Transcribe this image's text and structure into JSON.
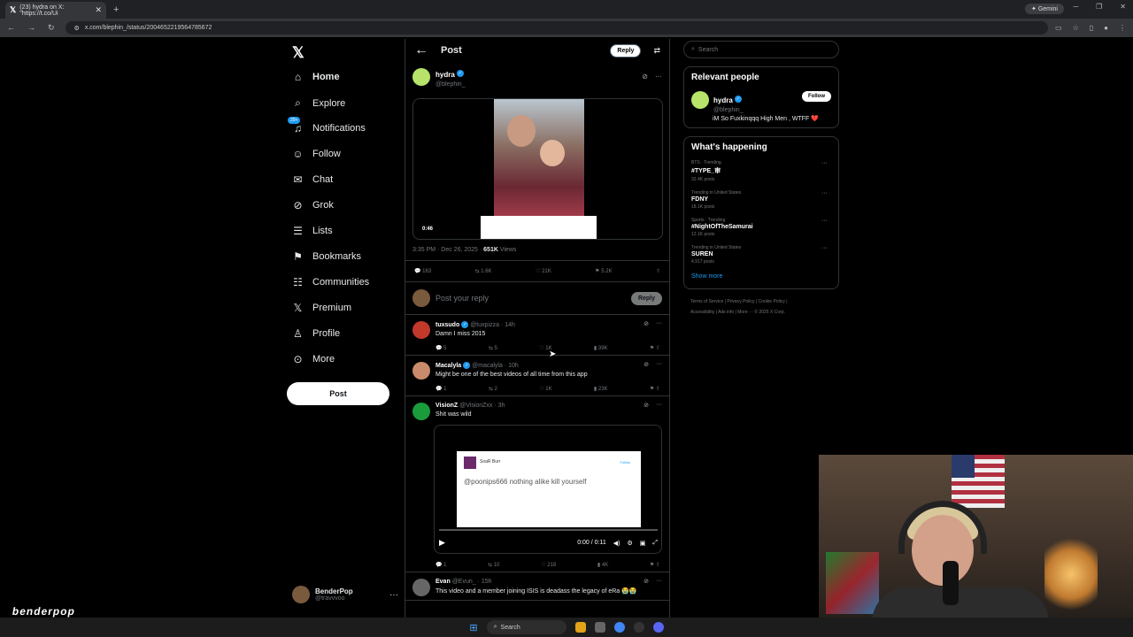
{
  "browser": {
    "tab_title": "(23) hydra on X: \"https://t.co/Ui",
    "gemini_label": "Gemini",
    "url": "x.com/blephin_/status/2004652219564785672"
  },
  "sidebar": {
    "items": [
      {
        "label": "Home",
        "icon": "home-icon"
      },
      {
        "label": "Explore",
        "icon": "search-icon"
      },
      {
        "label": "Notifications",
        "icon": "bell-icon",
        "badge": "20+"
      },
      {
        "label": "Follow",
        "icon": "add-person-icon"
      },
      {
        "label": "Chat",
        "icon": "mail-icon"
      },
      {
        "label": "Grok",
        "icon": "grok-icon"
      },
      {
        "label": "Lists",
        "icon": "list-icon"
      },
      {
        "label": "Bookmarks",
        "icon": "bookmark-icon"
      },
      {
        "label": "Communities",
        "icon": "people-icon"
      },
      {
        "label": "Premium",
        "icon": "x-icon"
      },
      {
        "label": "Profile",
        "icon": "person-icon"
      },
      {
        "label": "More",
        "icon": "more-icon"
      }
    ],
    "post_label": "Post",
    "account": {
      "name": "BenderPop",
      "handle": "@travvvoo"
    }
  },
  "main": {
    "title": "Post",
    "reply_label": "Reply",
    "tweet": {
      "name": "hydra",
      "handle": "@blephin_",
      "video_time": "0:46",
      "timestamp": "3:35 PM · Dec 26, 2025 · ",
      "views_count": "651K",
      "views_label": " Views",
      "stats": {
        "replies": "163",
        "reposts": "1.6K",
        "likes": "21K",
        "bookmarks": "5.2K"
      }
    },
    "compose_placeholder": "Post your reply",
    "compose_reply_label": "Reply",
    "replies": [
      {
        "name": "tuxsudo",
        "handle": "@tuxpizza · 14h",
        "text": "Damn I miss 2015",
        "replies": "5",
        "reposts": "5",
        "likes": "1K",
        "views": "39K",
        "avatar_color": "#c0392b"
      },
      {
        "name": "Macalyla",
        "handle": "@macalyla · 10h",
        "text": "Might be one of the best videos of all time from this app",
        "replies": "1",
        "reposts": "2",
        "likes": "1K",
        "views": "23K",
        "avatar_color": "#c98b6b"
      },
      {
        "name": "VisionZ",
        "handle": "@VisionZxx · 3h",
        "text": "Shit was wild",
        "replies": "1",
        "reposts": "10",
        "likes": "218",
        "views": "4K",
        "avatar_color": "#1a9b3c",
        "embed": {
          "username": "SoaR Burr",
          "follow": "Follow",
          "quote": "@poonips666 nothing alike kill yourself",
          "time": "0:00 / 0:11"
        }
      },
      {
        "name": "Evan",
        "handle": "@Evun_ · 15h",
        "text": "This video and a member joining ISIS is deadass the legacy of eRa 😭😭",
        "avatar_color": "#666"
      }
    ]
  },
  "right": {
    "search_placeholder": "Search",
    "relevant_title": "Relevant people",
    "relevant": {
      "name": "hydra",
      "handle": "@blephin_",
      "bio": "iM So Fuxkinqqq High Men , WTFF ❤️",
      "follow_label": "Follow"
    },
    "happening_title": "What's happening",
    "trends": [
      {
        "context": "BTS · Trending",
        "name": "#TYPE_审",
        "posts": "32.4K posts"
      },
      {
        "context": "Trending in United States",
        "name": "FDNY",
        "posts": "18.1K posts"
      },
      {
        "context": "Sports · Trending",
        "name": "#NightOfTheSamurai",
        "posts": "12.1K posts"
      },
      {
        "context": "Trending in United States",
        "name": "SUREN",
        "posts": "4,917 posts"
      }
    ],
    "show_more": "Show more",
    "footer": [
      "Terms of Service",
      "Privacy Policy",
      "Cookie Policy",
      "Accessibility",
      "Ads info",
      "More ···",
      "© 2025 X Corp."
    ]
  },
  "taskbar": {
    "search_label": "Search"
  },
  "overlay": {
    "watermark": "benderpop"
  }
}
